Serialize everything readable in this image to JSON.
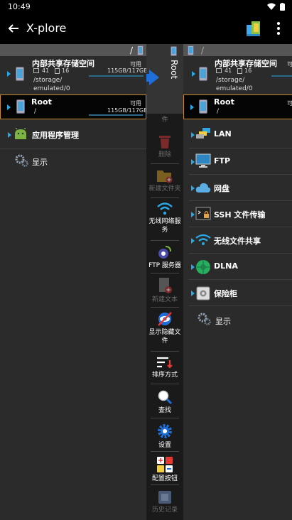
{
  "status": {
    "time": "10:49"
  },
  "appbar": {
    "title": "X-plore"
  },
  "left": {
    "path": "/",
    "internal": {
      "name": "内部共享存储空间",
      "available_label": "可用",
      "folders": "41",
      "files": "16",
      "size": "115GB/117GB",
      "path_line1": "/storage/",
      "path_line2": "emulated/0"
    },
    "root": {
      "name": "Root",
      "available_label": "可用",
      "path": "/",
      "size": "115GB/117GB"
    },
    "apps_label": "应用程序管理",
    "display_label": "显示"
  },
  "middle": {
    "vertical_label": "Root",
    "top_cut": "件",
    "tools": [
      {
        "label": "删除"
      },
      {
        "label": "新建文件夹"
      },
      {
        "label": "无线网络服务"
      },
      {
        "label": "FTP 服务器"
      },
      {
        "label": "新建文本"
      },
      {
        "label": "显示隐藏文件"
      },
      {
        "label": "排序方式"
      },
      {
        "label": "查找"
      },
      {
        "label": "设置"
      },
      {
        "label": "配置按钮"
      },
      {
        "label": "历史记录"
      }
    ]
  },
  "right": {
    "path": "/",
    "internal": {
      "name": "内部共享存储空间",
      "available_label": "可用",
      "folders": "41",
      "files": "16",
      "path_line1": "/storage/",
      "path_line2": "emulated/0"
    },
    "root": {
      "name": "Root",
      "available_label": "可用",
      "path": "/"
    },
    "items": [
      {
        "label": "LAN"
      },
      {
        "label": "FTP"
      },
      {
        "label": "网盘"
      },
      {
        "label": "SSH 文件传输"
      },
      {
        "label": "无线文件共享"
      },
      {
        "label": "DLNA"
      },
      {
        "label": "保险柜"
      },
      {
        "label": "显示"
      }
    ]
  },
  "colors": {
    "accent_blue": "#2aa8e6",
    "selection_orange": "#c88a2a",
    "delete_red": "#c0392b"
  }
}
